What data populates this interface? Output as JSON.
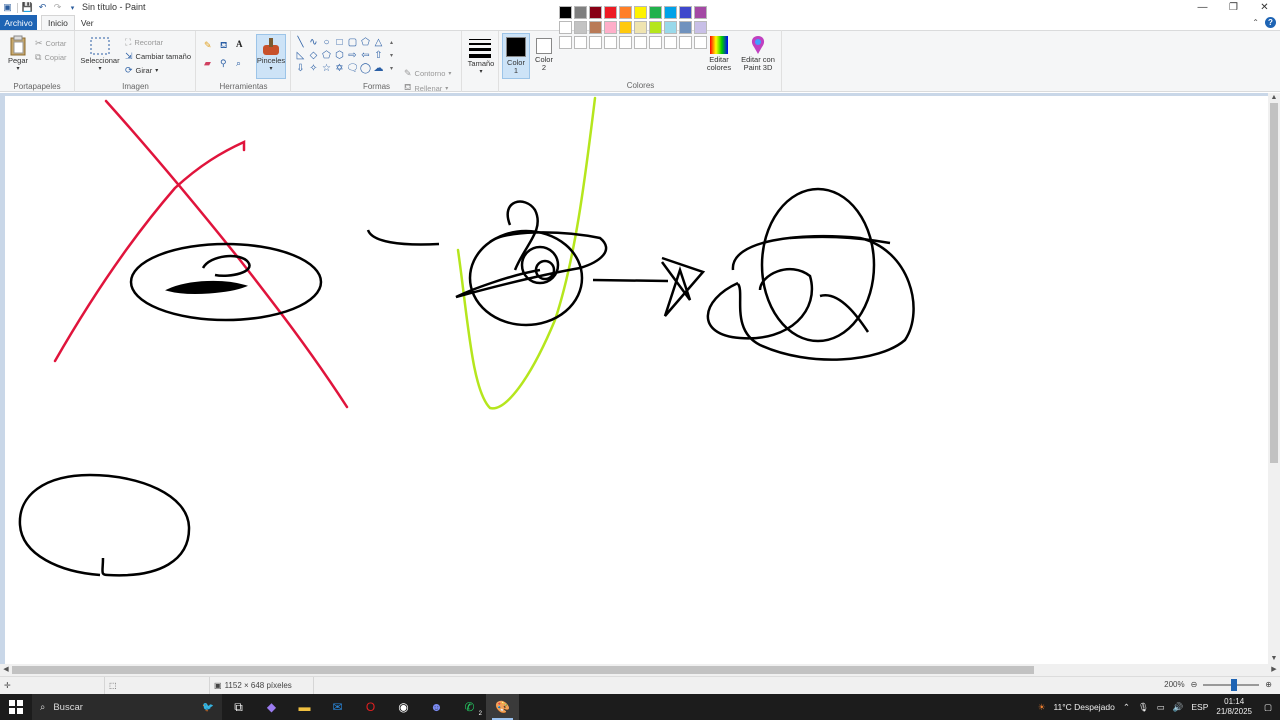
{
  "window": {
    "title": "Sin título - Paint",
    "controls": [
      "—",
      "❐",
      "✕"
    ]
  },
  "tabs": {
    "file": "Archivo",
    "home": "Inicio",
    "view": "Ver"
  },
  "ribbon": {
    "clipboard": {
      "label": "Portapapeles",
      "paste": "Pegar",
      "cut": "Cortar",
      "copy": "Copiar"
    },
    "image": {
      "label": "Imagen",
      "select": "Seleccionar",
      "crop": "Recortar",
      "resize": "Cambiar tamaño",
      "rotate": "Girar"
    },
    "tools": {
      "label": "Herramientas",
      "brushes": "Pinceles"
    },
    "shapes": {
      "label": "Formas",
      "outline": "Contorno",
      "fill": "Rellenar"
    },
    "size": {
      "label": "Tamaño"
    },
    "colors": {
      "label": "Colores",
      "color1": "Color\n1",
      "color2": "Color\n2",
      "color1_value": "#000000",
      "color2_value": "#ffffff",
      "edit_colors": "Editar\ncolores",
      "edit_3d": "Editar con\nPaint 3D",
      "palette": [
        "#000000",
        "#7f7f7f",
        "#880015",
        "#ed1c24",
        "#ff7f27",
        "#fff200",
        "#22b14c",
        "#00a2e8",
        "#3f48cc",
        "#a349a4",
        "#ffffff",
        "#c3c3c3",
        "#b97a57",
        "#ffaec9",
        "#ffc90e",
        "#efe4b0",
        "#b5e61d",
        "#99d9ea",
        "#7092be",
        "#c8bfe7",
        "#ffffff",
        "#ffffff",
        "#ffffff",
        "#ffffff",
        "#ffffff",
        "#ffffff",
        "#ffffff",
        "#ffffff",
        "#ffffff",
        "#ffffff"
      ]
    }
  },
  "canvas": {
    "stroke_red": "#e0143c",
    "stroke_green": "#b5e61d",
    "stroke_black": "#000000"
  },
  "status": {
    "dimensions": "1152 × 648 píxeles",
    "zoom": "200%",
    "zoom_level_fraction": 0.55
  },
  "taskbar": {
    "search": "Buscar",
    "weather": "11°C  Despejado",
    "lang": "ESP",
    "time": "01:14",
    "date": "21/8/2025",
    "whatsapp_badge": "2"
  }
}
